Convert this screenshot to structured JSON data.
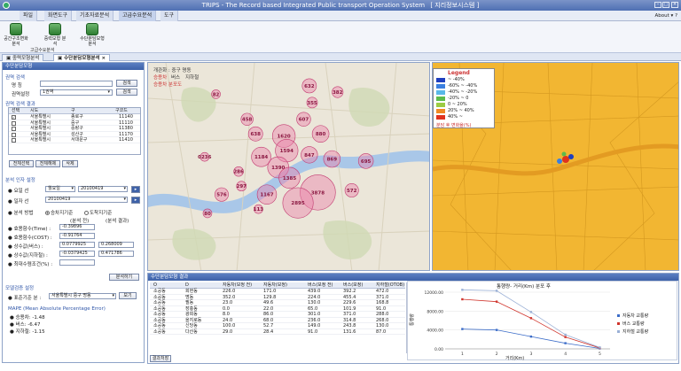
{
  "window": {
    "title": "TRIPS - The Record based Integrated Public transport Operation System",
    "extra": "[ 지리정보시스템 ]"
  },
  "menu": [
    "파일",
    "화면도구",
    "기초자료분석",
    "고급수요분석",
    "도구"
  ],
  "about": "About",
  "ribbon": {
    "buttons": [
      "공간구조변화 분석",
      "중력모형 분석",
      "수단분담모형 분석"
    ],
    "group_label": "고급수요분석"
  },
  "tabs": [
    "중력모형분석",
    "수단분담모형분석"
  ],
  "left_panel": {
    "title": "수단분담모형",
    "region_section": "권역 검색",
    "name_label": "명 칭",
    "search_button": "검색",
    "region_setting_label": "권역설정",
    "region_select": "1권역",
    "region_result_section": "권역 검색 결과",
    "columns": [
      "선택",
      "시도",
      "구",
      "구코드"
    ],
    "rows": [
      {
        "checked": true,
        "city": "서울특별시",
        "gu": "종로구",
        "code": "11140"
      },
      {
        "checked": false,
        "city": "서울특별시",
        "gu": "중구",
        "code": "11110"
      },
      {
        "checked": false,
        "city": "서울특별시",
        "gu": "중랑구",
        "code": "11380"
      },
      {
        "checked": false,
        "city": "서울특별시",
        "gu": "성산구",
        "code": "11170"
      },
      {
        "checked": false,
        "city": "서울특별시",
        "gu": "서대문구",
        "code": "11410"
      }
    ],
    "btn_select_all": "전체선택",
    "btn_clear_all": "전체해제",
    "btn_delete": "삭제",
    "analysis_section": "분석 인자 설정",
    "day_label": "요일 선",
    "day_select": "월요일",
    "day_date": "20100419",
    "date_label": "일자 선",
    "date_value": "20100419",
    "method_label": "분석 방법",
    "method_opt1": "승차지기준",
    "method_opt2": "도착지기준",
    "before_after": [
      "(분석 전)",
      "(분석 결과)"
    ],
    "params": [
      {
        "label": "효용함수(Time) :",
        "v1": "-0.39896",
        "v2": ""
      },
      {
        "label": "효용함수(COST) :",
        "v1": "-0.91764",
        "v2": ""
      },
      {
        "label": "상수값(버스) :",
        "v1": "0.0779925",
        "v2": "0.268009"
      },
      {
        "label": "상수값(지하철) :",
        "v1": "-0.0379425",
        "v2": "0.471786"
      },
      {
        "label": "최대수렴조건(%) :",
        "v1": "",
        "v2": ""
      }
    ],
    "run_button": "분석하기",
    "verify_section": "모델검증 설정",
    "basis_label": "표준기준 분 :",
    "basis_select": "서울특별시 중구 명동",
    "view_button": "보기",
    "mape_title": "MAPE (Mean Absolute Percentage Error)",
    "mape": [
      "승용차: -1.48",
      "버스: -6.47",
      "지하철: -1.15"
    ]
  },
  "map1": {
    "toolbar": [
      "승용차",
      "버스",
      "지하철"
    ],
    "header": "개관화 : 중구 명동",
    "sub": "승용차 분포도",
    "circles": [
      {
        "label": "632",
        "v": 632,
        "dx": 0.57,
        "dy": 0.11
      },
      {
        "label": "382",
        "v": 382,
        "dx": 0.67,
        "dy": 0.14
      },
      {
        "label": "82",
        "v": 82,
        "dx": 0.24,
        "dy": 0.15
      },
      {
        "label": "355",
        "v": 355,
        "dx": 0.58,
        "dy": 0.19
      },
      {
        "label": "458",
        "v": 458,
        "dx": 0.35,
        "dy": 0.27
      },
      {
        "label": "607",
        "v": 607,
        "dx": 0.55,
        "dy": 0.27
      },
      {
        "label": "1620",
        "v": 1620,
        "dx": 0.48,
        "dy": 0.35
      },
      {
        "label": "880",
        "v": 880,
        "dx": 0.61,
        "dy": 0.34
      },
      {
        "label": "638",
        "v": 638,
        "dx": 0.38,
        "dy": 0.34
      },
      {
        "label": "1594",
        "v": 1594,
        "dx": 0.49,
        "dy": 0.42
      },
      {
        "label": "847",
        "v": 847,
        "dx": 0.57,
        "dy": 0.44
      },
      {
        "label": "1184",
        "v": 1184,
        "dx": 0.4,
        "dy": 0.45
      },
      {
        "label": "0236",
        "v": 236,
        "dx": 0.2,
        "dy": 0.45
      },
      {
        "label": "1390",
        "v": 1390,
        "dx": 0.46,
        "dy": 0.5
      },
      {
        "label": "869",
        "v": 869,
        "dx": 0.65,
        "dy": 0.46
      },
      {
        "label": "695",
        "v": 695,
        "dx": 0.77,
        "dy": 0.47
      },
      {
        "label": "1385",
        "v": 1385,
        "dx": 0.5,
        "dy": 0.55
      },
      {
        "label": "286",
        "v": 286,
        "dx": 0.32,
        "dy": 0.52
      },
      {
        "label": "576",
        "v": 576,
        "dx": 0.26,
        "dy": 0.63
      },
      {
        "label": "297",
        "v": 297,
        "dx": 0.33,
        "dy": 0.59
      },
      {
        "label": "1167",
        "v": 1167,
        "dx": 0.42,
        "dy": 0.63
      },
      {
        "label": "3878",
        "v": 3878,
        "dx": 0.6,
        "dy": 0.62
      },
      {
        "label": "2895",
        "v": 2895,
        "dx": 0.53,
        "dy": 0.67
      },
      {
        "label": "572",
        "v": 572,
        "dx": 0.72,
        "dy": 0.61
      },
      {
        "label": "80",
        "v": 80,
        "dx": 0.21,
        "dy": 0.72
      },
      {
        "label": "113",
        "v": 113,
        "dx": 0.39,
        "dy": 0.7
      }
    ]
  },
  "map2": {
    "legend_title": "Legend",
    "legend": [
      {
        "color": "#1f3fbf",
        "text": "~ -40%"
      },
      {
        "color": "#3b7fe0",
        "text": "-60% ~ -40%"
      },
      {
        "color": "#58b8e8",
        "text": "-40% ~ -20%"
      },
      {
        "color": "#5dbb4c",
        "text": "-20% ~ 0"
      },
      {
        "color": "#9ccc43",
        "text": "0 ~ 20%"
      },
      {
        "color": "#f08a24",
        "text": "20% ~ 40%"
      },
      {
        "color": "#e0321e",
        "text": "40% ~"
      }
    ],
    "legend_note": "분담 후 변화율(%)"
  },
  "results": {
    "title": "수단분담모형 결과",
    "columns": [
      "O",
      "D",
      "자동차(보정 전)",
      "자동차(보정)",
      "버스(보정 전)",
      "버스(보정)",
      "지하철(OTOB)"
    ],
    "rows": [
      [
        "소공동",
        "회현동",
        "226.0",
        "171.0",
        "439.0",
        "392.2",
        "472.0"
      ],
      [
        "소공동",
        "명동",
        "352.0",
        "129.8",
        "224.0",
        "455.4",
        "371.0"
      ],
      [
        "소공동",
        "필동",
        "23.0",
        "49.6",
        "130.0",
        "229.6",
        "168.8"
      ],
      [
        "소공동",
        "장충동",
        "0.0",
        "22.0",
        "65.0",
        "101.9",
        "91.0"
      ],
      [
        "소공동",
        "광희동",
        "8.0",
        "86.0",
        "301.0",
        "371.0",
        "288.0"
      ],
      [
        "소공동",
        "을지로동",
        "24.0",
        "68.0",
        "236.0",
        "314.8",
        "268.0"
      ],
      [
        "소공동",
        "신당동",
        "100.0",
        "52.7",
        "149.0",
        "243.8",
        "130.0"
      ],
      [
        "소공동",
        "다산동",
        "29.0",
        "28.4",
        "91.0",
        "131.6",
        "87.0"
      ]
    ],
    "save_button": "결과저장"
  },
  "chart_data": {
    "type": "line",
    "title": "통행량- 거리(Km) 분포 후",
    "xlabel": "거리(Km)",
    "ylabel": "통행량",
    "x": [
      1,
      2,
      3,
      4,
      5
    ],
    "ylim": [
      0,
      12000
    ],
    "yticks": [
      "12000.00",
      "8000.00",
      "4000.00",
      "0.00"
    ],
    "series": [
      {
        "name": "자동차 교통량",
        "color": "#3b6cc8",
        "values": [
          4200,
          4000,
          2600,
          1200,
          100
        ]
      },
      {
        "name": "버스 교통량",
        "color": "#d0342c",
        "values": [
          10500,
          10000,
          6500,
          2500,
          200
        ]
      },
      {
        "name": "지하철 교통량",
        "color": "#9ab0d6",
        "values": [
          12500,
          12300,
          7800,
          3000,
          300
        ]
      }
    ]
  }
}
